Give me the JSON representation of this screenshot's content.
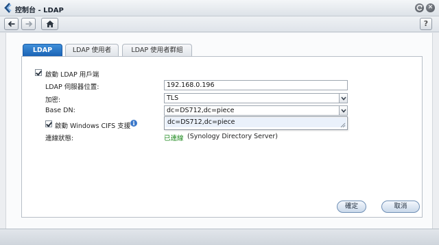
{
  "window": {
    "title": "控制台 - LDAP",
    "minimize_icon": "refresh-icon",
    "close_icon": "close-icon",
    "close_symbol": "✕"
  },
  "toolbar": {
    "back_icon": "arrow-left-icon",
    "forward_icon": "arrow-right-icon",
    "home_icon": "home-icon",
    "help_label": "?"
  },
  "tabs": [
    {
      "label": "LDAP",
      "active": true
    },
    {
      "label": "LDAP 使用者",
      "active": false
    },
    {
      "label": "LDAP 使用者群組",
      "active": false
    }
  ],
  "form": {
    "enable_client_label": "啟動 LDAP 用戶端",
    "enable_client_checked": true,
    "server_label": "LDAP 伺服器位置:",
    "server_value": "192.168.0.196",
    "encryption_label": "加密:",
    "encryption_value": "TLS",
    "basedn_label": "Base DN:",
    "basedn_value": "dc=DS712,dc=piece",
    "basedn_options": [
      "dc=DS712,dc=piece"
    ],
    "cifs_label": "啟動 Windows CIFS 支援",
    "cifs_checked": true,
    "info_symbol": "i",
    "status_label": "連線狀態:",
    "status_value": "已連線",
    "status_detail": "(Synology Directory Server)"
  },
  "buttons": {
    "ok_label": "確定",
    "cancel_label": "取消"
  },
  "colors": {
    "accent": "#1b63b5",
    "status_ok": "#1f8a1f"
  }
}
